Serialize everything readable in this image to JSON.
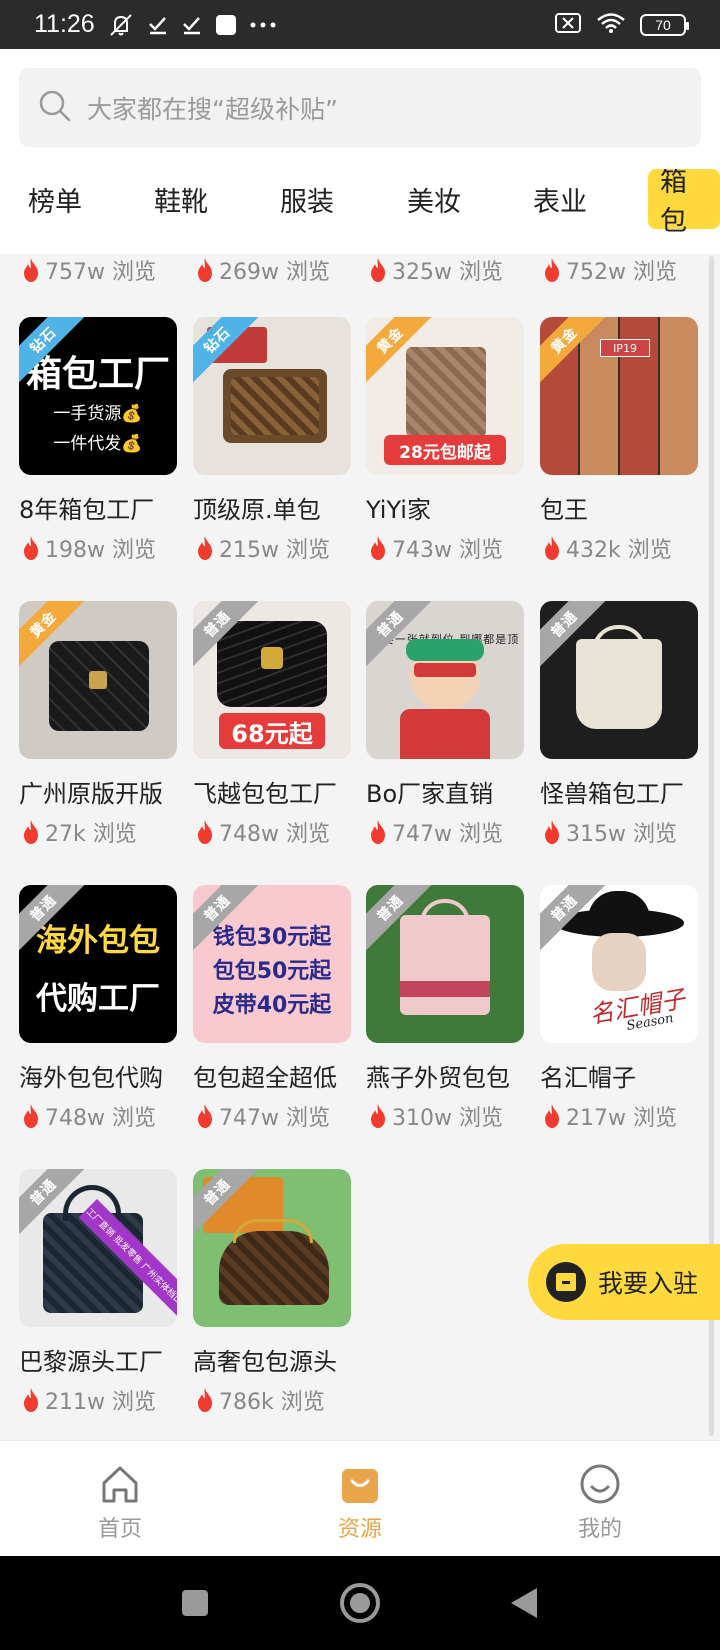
{
  "status_bar": {
    "time": "11:26",
    "icons": [
      "mute-icon",
      "check-icon",
      "check-icon",
      "app-icon",
      "more-icon"
    ],
    "right_icons": [
      "sim-off-icon",
      "wifi-icon"
    ],
    "battery": "70"
  },
  "search": {
    "placeholder": "大家都在搜“超级补贴”"
  },
  "tabs": [
    {
      "label": "榜单"
    },
    {
      "label": "鞋靴"
    },
    {
      "label": "服装"
    },
    {
      "label": "美妆"
    },
    {
      "label": "表业"
    },
    {
      "label": "箱包",
      "active": true
    }
  ],
  "top_views": [
    "757w 浏览",
    "269w 浏览",
    "325w 浏览",
    "752w 浏览"
  ],
  "badges": {
    "diamond": "钻石",
    "gold": "黄金",
    "normal": "普通"
  },
  "thumb_texts": {
    "factory_title": "箱包工厂",
    "factory_line1": "一手货源💰",
    "factory_line2": "一件代发💰",
    "promo_28": "28元包邮起",
    "promo_68": "68元起",
    "overseas_line1": "海外包包",
    "overseas_line2": "代购工厂",
    "price_line1": "钱包30元起",
    "price_line2": "包包50元起",
    "price_line3": "皮带40元起",
    "ip_label": "IP19",
    "kid_text": "只要一张就到位 到哪都是顶呢",
    "wholesale_tag": "一件代发 工厂直销 批发零售 广州实体档口可随时看货",
    "hat_sign": "名汇帽子",
    "hat_sign_en": "Season"
  },
  "shops": [
    {
      "name": "8年箱包工厂",
      "views": "198w 浏览",
      "badge": "diamond"
    },
    {
      "name": "顶级原.单包",
      "views": "215w 浏览",
      "badge": "diamond"
    },
    {
      "name": "YiYi家",
      "views": "743w 浏览",
      "badge": "gold"
    },
    {
      "name": "包王",
      "views": "432k 浏览",
      "badge": "gold"
    },
    {
      "name": "广州原版开版",
      "views": "27k 浏览",
      "badge": "gold"
    },
    {
      "name": "飞越包包工厂",
      "views": "748w 浏览",
      "badge": "normal"
    },
    {
      "name": "Bo厂家直销",
      "views": "747w 浏览",
      "badge": "normal"
    },
    {
      "name": "怪兽箱包工厂",
      "views": "315w 浏览",
      "badge": "normal"
    },
    {
      "name": "海外包包代购",
      "views": "748w 浏览",
      "badge": "normal"
    },
    {
      "name": "包包超全超低",
      "views": "747w 浏览",
      "badge": "normal"
    },
    {
      "name": "燕子外贸包包",
      "views": "310w 浏览",
      "badge": "normal"
    },
    {
      "name": "名汇帽子",
      "views": "217w 浏览",
      "badge": "normal"
    },
    {
      "name": "巴黎源头工厂",
      "views": "211w 浏览",
      "badge": "normal"
    },
    {
      "name": "高奢包包源头",
      "views": "786k 浏览",
      "badge": "normal"
    }
  ],
  "join_button": {
    "label": "我要入驻"
  },
  "bottom_nav": [
    {
      "label": "首页",
      "icon": "home-icon"
    },
    {
      "label": "资源",
      "icon": "bag-icon",
      "active": true
    },
    {
      "label": "我的",
      "icon": "smile-icon"
    }
  ],
  "colors": {
    "accent": "#ffd93d",
    "active_nav": "#e9a54b",
    "flame": "#f23b2f"
  }
}
